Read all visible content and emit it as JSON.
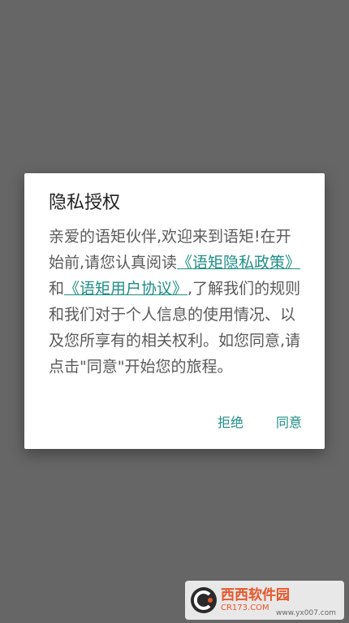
{
  "dialog": {
    "title": "隐私授权",
    "body_part1": "亲爱的语矩伙伴,欢迎来到语矩!在开始前,请您认真阅读",
    "privacy_link": "《语矩隐私政策》",
    "and_text": "和",
    "user_agreement_link": "《语矩用户协议》",
    "body_part2": ",了解我们的规则和我们对于个人信息的使用情况、以及您所享有的相关权利。如您同意,请点击\"同意\"开始您的旅程。",
    "reject_label": "拒绝",
    "agree_label": "同意"
  },
  "colors": {
    "accent": "#1f8f86",
    "scrim": "#666666"
  },
  "watermark": {
    "brand": "西西软件园",
    "sub": "CR173.COM",
    "url": "www.yx007.com"
  }
}
